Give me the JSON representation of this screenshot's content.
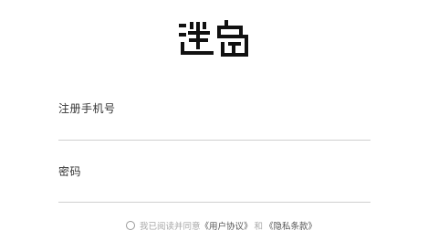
{
  "logo": {
    "text": "迷岛",
    "icon": "mi-dao-logo"
  },
  "form": {
    "phone_label": "注册手机号",
    "phone_value": "",
    "password_label": "密码",
    "password_value": ""
  },
  "agreement": {
    "checked": false,
    "prefix": "我已阅读并同意",
    "user_agreement": "《用户协议》",
    "conjunction": "和",
    "privacy_policy": "《隐私条款》"
  },
  "colors": {
    "background": "#ffffff",
    "text": "#333333",
    "muted": "#aaaaaa",
    "divider": "#cfcfcf"
  }
}
